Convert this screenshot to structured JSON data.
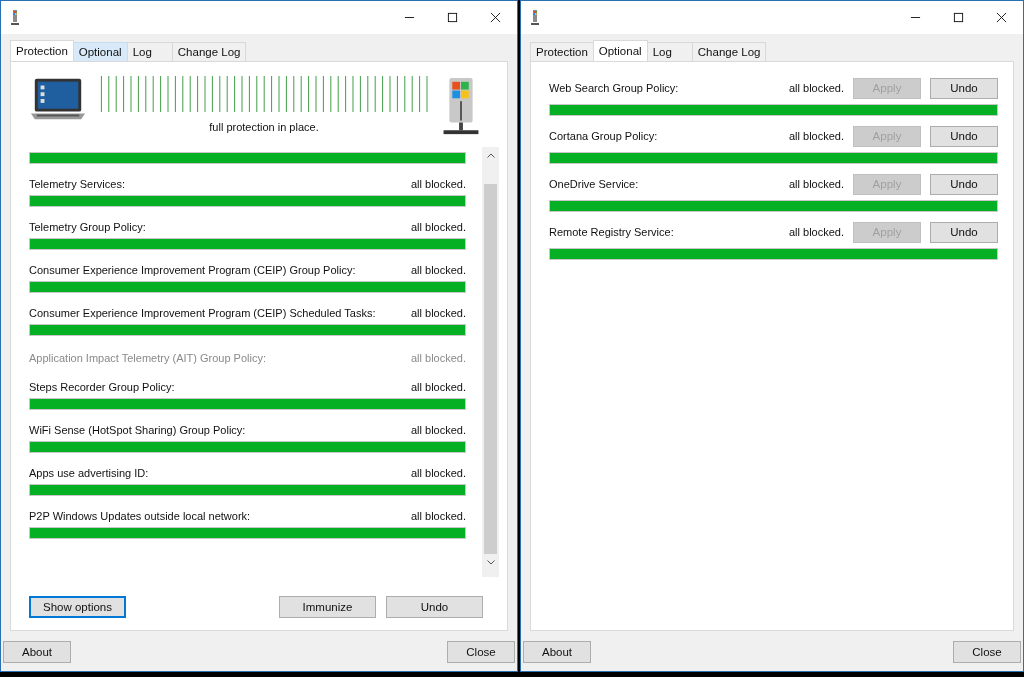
{
  "windows": [
    {
      "tabs": [
        {
          "label": "Protection",
          "selected": true,
          "hovered": false
        },
        {
          "label": "Optional",
          "selected": false,
          "hovered": true
        },
        {
          "label": "Log",
          "selected": false,
          "hovered": false
        },
        {
          "label": "Change Log",
          "selected": false,
          "hovered": false
        }
      ],
      "status_message": "full protection in place.",
      "overall": {
        "level": 1
      },
      "items": [
        {
          "name": "Telemetry Services:",
          "status": "all blocked.",
          "disabled": false,
          "level": 1
        },
        {
          "name": "Telemetry Group Policy:",
          "status": "all blocked.",
          "disabled": false,
          "level": 1
        },
        {
          "name": "Consumer Experience Improvement Program (CEIP) Group Policy:",
          "status": "all blocked.",
          "disabled": false,
          "level": 1
        },
        {
          "name": "Consumer Experience Improvement Program (CEIP) Scheduled Tasks:",
          "status": "all blocked.",
          "disabled": false,
          "level": 1
        },
        {
          "name": "Application Impact Telemetry (AIT) Group Policy:",
          "status": "all blocked.",
          "disabled": true
        },
        {
          "name": "Steps Recorder Group Policy:",
          "status": "all blocked.",
          "disabled": false,
          "level": 1
        },
        {
          "name": "WiFi Sense (HotSpot Sharing) Group Policy:",
          "status": "all blocked.",
          "disabled": false,
          "level": 1
        },
        {
          "name": "Apps use advertising ID:",
          "status": "all blocked.",
          "disabled": false,
          "level": 1
        },
        {
          "name": "P2P Windows Updates outside local network:",
          "status": "all blocked.",
          "disabled": false,
          "level": 1
        }
      ],
      "panel_buttons": [
        {
          "label": "Show options",
          "focused": true
        },
        {
          "label": "Immunize",
          "focused": false
        },
        {
          "label": "Undo",
          "focused": false
        }
      ],
      "footer_buttons": [
        "About",
        "Close"
      ]
    },
    {
      "tabs": [
        {
          "label": "Protection",
          "selected": false,
          "hovered": false
        },
        {
          "label": "Optional",
          "selected": true,
          "hovered": false
        },
        {
          "label": "Log",
          "selected": false,
          "hovered": false
        },
        {
          "label": "Change Log",
          "selected": false,
          "hovered": false
        }
      ],
      "options": [
        {
          "name": "Web Search Group Policy:",
          "status": "all blocked.",
          "level": 1,
          "buttons": [
            {
              "label": "Apply",
              "disabled": true
            },
            {
              "label": "Undo",
              "disabled": false
            }
          ]
        },
        {
          "name": "Cortana Group Policy:",
          "status": "all blocked.",
          "level": 1,
          "buttons": [
            {
              "label": "Apply",
              "disabled": true
            },
            {
              "label": "Undo",
              "disabled": false
            }
          ]
        },
        {
          "name": "OneDrive Service:",
          "status": "all blocked.",
          "level": 1,
          "buttons": [
            {
              "label": "Apply",
              "disabled": true
            },
            {
              "label": "Undo",
              "disabled": false
            }
          ]
        },
        {
          "name": "Remote Registry Service:",
          "status": "all blocked.",
          "level": 1,
          "buttons": [
            {
              "label": "Apply",
              "disabled": true
            },
            {
              "label": "Undo",
              "disabled": false
            }
          ]
        }
      ],
      "footer_buttons": [
        "About",
        "Close"
      ]
    }
  ]
}
